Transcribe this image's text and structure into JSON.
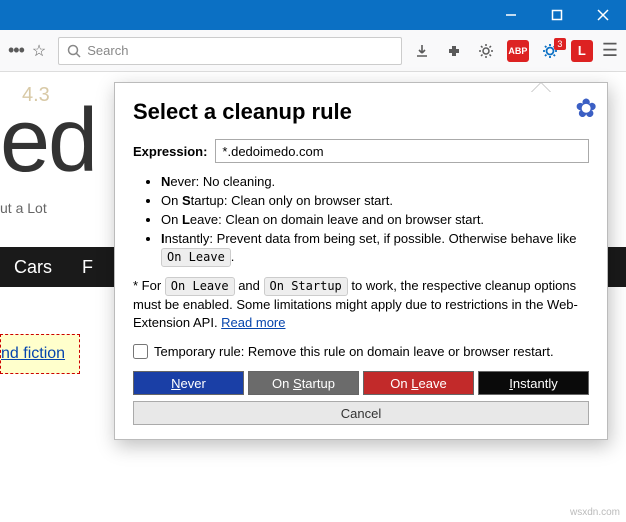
{
  "window": {
    "minimize_icon": "minimize-icon",
    "maximize_icon": "maximize-icon",
    "close_icon": "close-icon"
  },
  "toolbar": {
    "search_placeholder": "Search",
    "abp_label": "ABP",
    "badge_count": "3",
    "lastpass_label": "L"
  },
  "background": {
    "faded_text": "4.3",
    "big_text": "ed",
    "subtitle": "ut a Lot",
    "tabs": {
      "first": "Cars",
      "second": "F"
    },
    "yellow_link": "nd fiction"
  },
  "popup": {
    "title": "Select a cleanup rule",
    "expression_label": "Expression:",
    "expression_value": "*.dedoimedo.com",
    "rules": {
      "never": {
        "key": "N",
        "rest": "ever: No cleaning."
      },
      "startup": {
        "prefix": "On ",
        "key": "S",
        "rest": "tartup: Clean only on browser start."
      },
      "leave": {
        "prefix": "On ",
        "key": "L",
        "rest": "eave: Clean on domain leave and on browser start."
      },
      "instantly": {
        "key": "I",
        "rest": "nstantly: Prevent data from being set, if possible. Otherwise behave like ",
        "code": "On Leave",
        "tail": "."
      }
    },
    "note": {
      "prefix": "* For ",
      "code1": "On Leave",
      "mid": " and ",
      "code2": "On Startup",
      "rest": " to work, the respective cleanup options must be enabled. Some limitations might apply due to restrictions in the Web-Extension API. ",
      "link": "Read more"
    },
    "temporary": {
      "label": "Temporary rule: Remove this rule on domain leave or browser restart."
    },
    "buttons": {
      "never": {
        "u": "N",
        "rest": "ever"
      },
      "startup": {
        "pre": "On ",
        "u": "S",
        "rest": "tartup"
      },
      "leave": {
        "pre": "On ",
        "u": "L",
        "rest": "eave"
      },
      "instantly": {
        "u": "I",
        "rest": "nstantly"
      },
      "cancel": "Cancel"
    }
  },
  "watermark": "wsxdn.com"
}
